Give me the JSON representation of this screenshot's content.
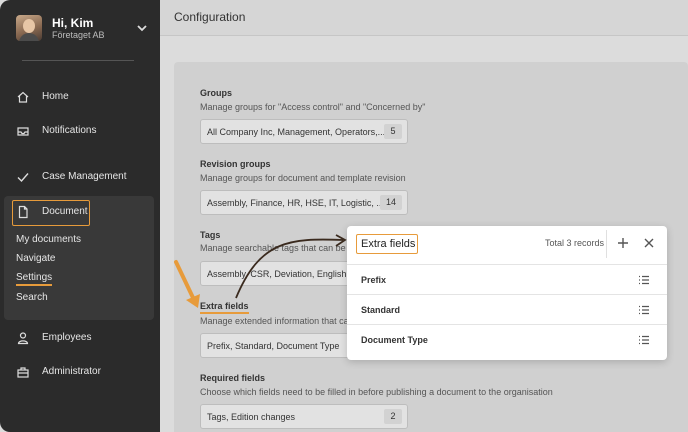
{
  "user": {
    "name": "Hi, Kim",
    "company": "Företaget AB"
  },
  "sidebar": {
    "items": [
      {
        "label": "Home"
      },
      {
        "label": "Notifications"
      },
      {
        "label": "Case Management"
      },
      {
        "label": "Document"
      },
      {
        "label": "Employees"
      },
      {
        "label": "Administrator"
      }
    ],
    "document_sub": [
      {
        "label": "My documents"
      },
      {
        "label": "Navigate"
      },
      {
        "label": "Settings"
      },
      {
        "label": "Search"
      }
    ]
  },
  "header": {
    "title": "Configuration"
  },
  "sections": [
    {
      "title": "Groups",
      "desc": "Manage groups for \"Access control\" and \"Concerned by\"",
      "value": "All Company Inc, Management, Operators,...",
      "count": "5"
    },
    {
      "title": "Revision groups",
      "desc": "Manage groups for document and template revision",
      "value": "Assembly, Finance, HR, HSE, IT, Logistic, ...",
      "count": "14"
    },
    {
      "title": "Tags",
      "desc": "Manage searchable tags that can be e",
      "value": "Assembly, CSR, Deviation, English, E",
      "count": ""
    },
    {
      "title": "Extra fields",
      "desc": "Manage extended information that ca",
      "value": "Prefix, Standard, Document Type",
      "count": ""
    },
    {
      "title": "Required fields",
      "desc": "Choose which fields need to be filled in before publishing a document to the organisation",
      "value": "Tags, Edition changes",
      "count": "2"
    }
  ],
  "popup": {
    "title": "Extra fields",
    "total": "Total 3 records",
    "rows": [
      {
        "label": "Prefix"
      },
      {
        "label": "Standard"
      },
      {
        "label": "Document Type"
      }
    ]
  },
  "colors": {
    "accent": "#e79b3b",
    "sidebar_bg": "#2b2b2b",
    "arrow": "#3a2a1e"
  }
}
